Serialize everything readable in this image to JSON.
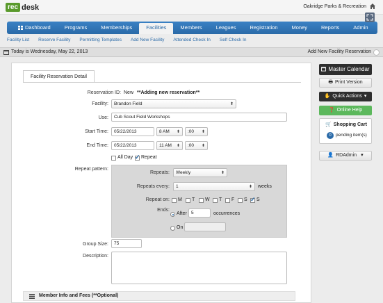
{
  "brand": {
    "logo_rec": "rec",
    "logo_desk": "desk"
  },
  "org_name": "Oakridge Parks & Recreation",
  "nav": {
    "items": [
      {
        "label": "Dashboard"
      },
      {
        "label": "Programs"
      },
      {
        "label": "Memberships"
      },
      {
        "label": "Facilities"
      },
      {
        "label": "Members"
      },
      {
        "label": "Leagues"
      },
      {
        "label": "Registration"
      },
      {
        "label": "Money"
      },
      {
        "label": "Reports"
      },
      {
        "label": "Admin"
      }
    ],
    "active": "Facilities"
  },
  "subnav": {
    "items": [
      {
        "label": "Facility List"
      },
      {
        "label": "Reserve Facility"
      },
      {
        "label": "Permitting Templates"
      },
      {
        "label": "Add New Facility"
      },
      {
        "label": "Attended Check In"
      },
      {
        "label": "Self Check In"
      }
    ]
  },
  "datebar": {
    "today": "Today is Wednesday, May 22, 2013",
    "crumb": "Add New Facility Reservation"
  },
  "form": {
    "tab_label": "Facility Reservation Detail",
    "reservation_id_label": "Reservation ID:",
    "reservation_id_value": "New",
    "reservation_id_note": "**Adding new reservation**",
    "facility_label": "Facility:",
    "facility_value": "Brandon Field",
    "use_label": "Use:",
    "use_value": "Cub Scout Field Workshops",
    "start_time_label": "Start Time:",
    "start_date": "05/22/2013",
    "start_hour": "8 AM",
    "start_min": ":00",
    "end_time_label": "End Time:",
    "end_date": "05/22/2013",
    "end_hour": "11 AM",
    "end_min": ":00",
    "all_day_label": "All Day",
    "all_day_checked": false,
    "repeat_label": "Repeat",
    "repeat_checked": true,
    "repeat_pattern_label": "Repeat pattern:",
    "repeats_label": "Repeats:",
    "repeats_value": "Weekly",
    "repeats_every_label": "Repeats every:",
    "repeats_every_value": "1",
    "repeats_every_unit": "weeks",
    "repeat_on_label": "Repeat on:",
    "days": [
      {
        "label": "M",
        "checked": false
      },
      {
        "label": "T",
        "checked": false
      },
      {
        "label": "W",
        "checked": false
      },
      {
        "label": "T",
        "checked": false
      },
      {
        "label": "F",
        "checked": false
      },
      {
        "label": "S",
        "checked": false
      },
      {
        "label": "S",
        "checked": true
      }
    ],
    "ends_label": "Ends:",
    "ends_after_label": "After",
    "ends_after_value": "5",
    "occurrences_label": "occurrences",
    "ends_on_label": "On",
    "ends_selected": "after",
    "group_size_label": "Group Size:",
    "group_size_value": "75",
    "description_label": "Description:",
    "description_value": "",
    "member_section_label": "Member Info and Fees (**Optional)"
  },
  "sidebar": {
    "master_calendar": "Master Calendar",
    "print_version": "Print Version",
    "quick_actions": "Quick Actions",
    "online_help": "Online Help",
    "cart_title": "Shopping Cart",
    "cart_count": "0",
    "cart_pending": "pending item(s)",
    "user_menu": "RDAdmin"
  },
  "colors": {
    "nav_blue": "#2a6aa8",
    "brand_green": "#5a9a2c",
    "help_green": "#5cb85c"
  }
}
